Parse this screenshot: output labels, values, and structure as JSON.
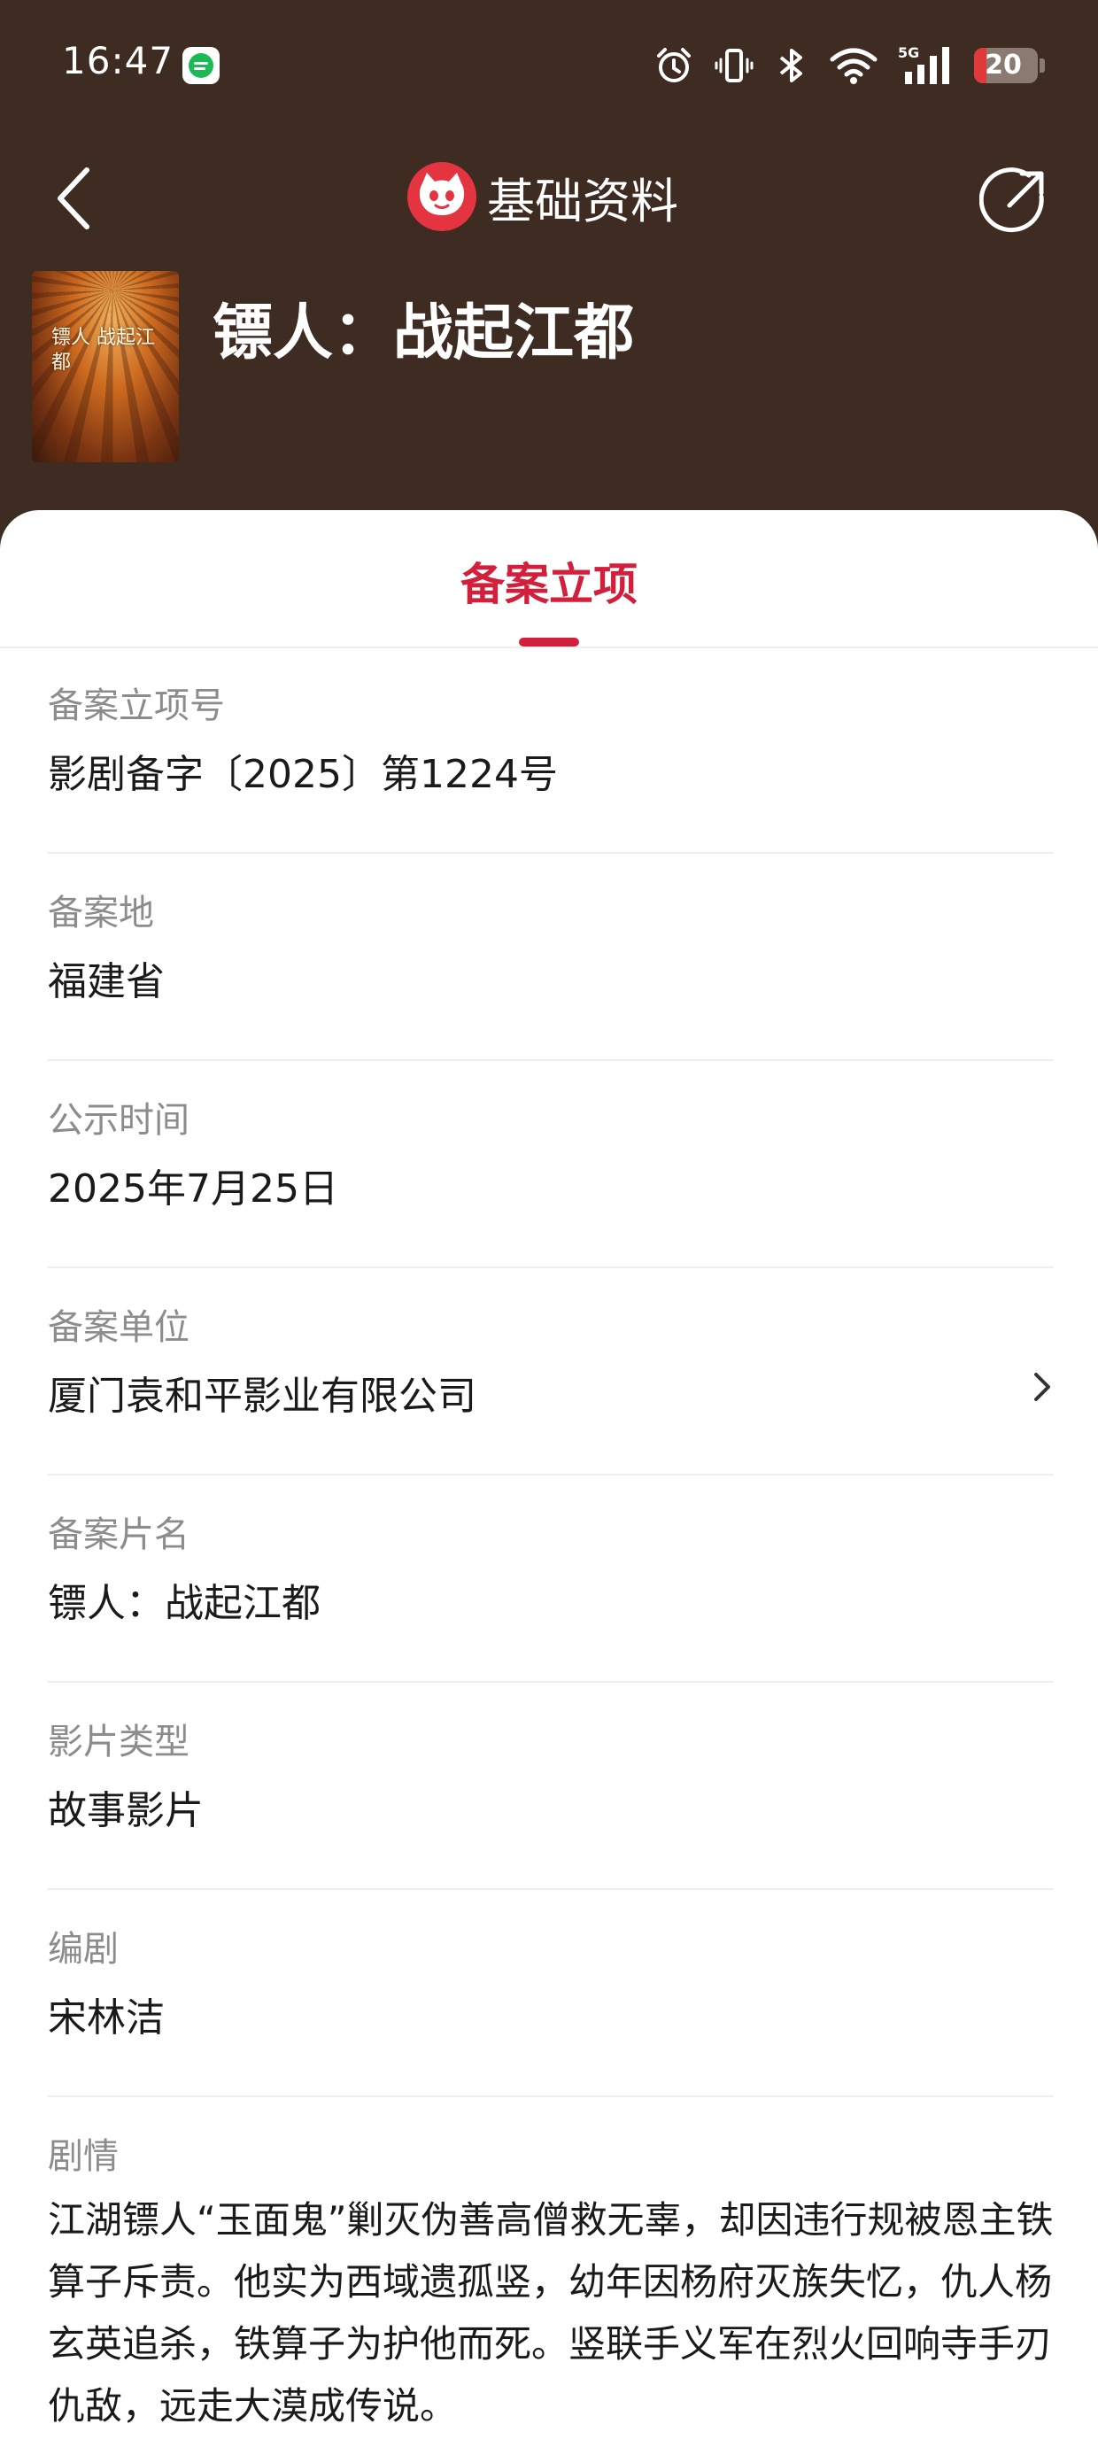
{
  "status_bar": {
    "time": "16:47",
    "network": "5G",
    "battery_level": 20,
    "battery_text": "20",
    "icons": [
      "spotify-icon",
      "alarm-icon",
      "vibrate-icon",
      "bluetooth-icon",
      "wifi-icon",
      "signal-icon",
      "battery-icon"
    ]
  },
  "header": {
    "title": "基础资料",
    "movie_title": "镖人：战起江都",
    "poster_text": "镖人 战起江都"
  },
  "tabs": [
    {
      "label": "备案立项",
      "active": true
    }
  ],
  "fields": [
    {
      "label": "备案立项号",
      "value": "影剧备字〔2025〕第1224号"
    },
    {
      "label": "备案地",
      "value": "福建省"
    },
    {
      "label": "公示时间",
      "value": "2025年7月25日"
    },
    {
      "label": "备案单位",
      "value": "厦门袁和平影业有限公司"
    },
    {
      "label": "备案片名",
      "value": "镖人：战起江都"
    },
    {
      "label": "影片类型",
      "value": "故事影片"
    },
    {
      "label": "编剧",
      "value": "宋林洁"
    }
  ],
  "plot": {
    "label": "剧情",
    "text": "江湖镖人“玉面鬼”剿灭伪善高僧救无辜，却因违行规被恩主铁算子斥责。他实为西域遗孤竖，幼年因杨府灭族失忆，仇人杨玄英追杀，铁算子为护他而死。竖联手义军在烈火回响寺手刃仇敌，远走大漠成传说。"
  },
  "colors": {
    "header_bg": "#3e2b22",
    "accent": "#d21f3c",
    "label": "#8c8c8c",
    "value": "#1a1a1a"
  }
}
